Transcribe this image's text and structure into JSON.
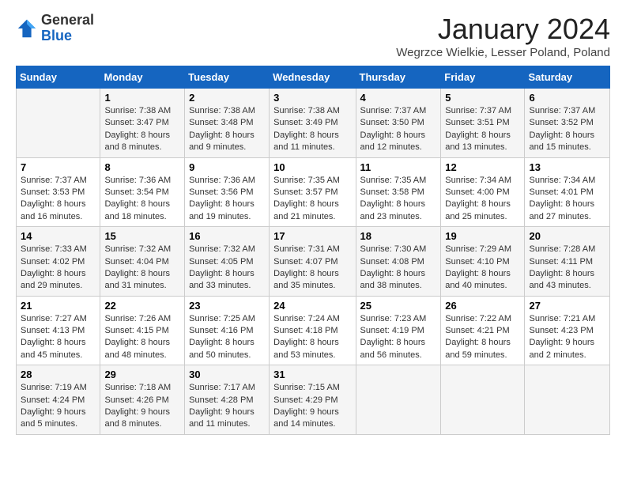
{
  "header": {
    "logo_general": "General",
    "logo_blue": "Blue",
    "month_title": "January 2024",
    "location": "Wegrzce Wielkie, Lesser Poland, Poland"
  },
  "days_of_week": [
    "Sunday",
    "Monday",
    "Tuesday",
    "Wednesday",
    "Thursday",
    "Friday",
    "Saturday"
  ],
  "weeks": [
    [
      {
        "day": "",
        "sunrise": "",
        "sunset": "",
        "daylight": ""
      },
      {
        "day": "1",
        "sunrise": "Sunrise: 7:38 AM",
        "sunset": "Sunset: 3:47 PM",
        "daylight": "Daylight: 8 hours and 8 minutes."
      },
      {
        "day": "2",
        "sunrise": "Sunrise: 7:38 AM",
        "sunset": "Sunset: 3:48 PM",
        "daylight": "Daylight: 8 hours and 9 minutes."
      },
      {
        "day": "3",
        "sunrise": "Sunrise: 7:38 AM",
        "sunset": "Sunset: 3:49 PM",
        "daylight": "Daylight: 8 hours and 11 minutes."
      },
      {
        "day": "4",
        "sunrise": "Sunrise: 7:37 AM",
        "sunset": "Sunset: 3:50 PM",
        "daylight": "Daylight: 8 hours and 12 minutes."
      },
      {
        "day": "5",
        "sunrise": "Sunrise: 7:37 AM",
        "sunset": "Sunset: 3:51 PM",
        "daylight": "Daylight: 8 hours and 13 minutes."
      },
      {
        "day": "6",
        "sunrise": "Sunrise: 7:37 AM",
        "sunset": "Sunset: 3:52 PM",
        "daylight": "Daylight: 8 hours and 15 minutes."
      }
    ],
    [
      {
        "day": "7",
        "sunrise": "Sunrise: 7:37 AM",
        "sunset": "Sunset: 3:53 PM",
        "daylight": "Daylight: 8 hours and 16 minutes."
      },
      {
        "day": "8",
        "sunrise": "Sunrise: 7:36 AM",
        "sunset": "Sunset: 3:54 PM",
        "daylight": "Daylight: 8 hours and 18 minutes."
      },
      {
        "day": "9",
        "sunrise": "Sunrise: 7:36 AM",
        "sunset": "Sunset: 3:56 PM",
        "daylight": "Daylight: 8 hours and 19 minutes."
      },
      {
        "day": "10",
        "sunrise": "Sunrise: 7:35 AM",
        "sunset": "Sunset: 3:57 PM",
        "daylight": "Daylight: 8 hours and 21 minutes."
      },
      {
        "day": "11",
        "sunrise": "Sunrise: 7:35 AM",
        "sunset": "Sunset: 3:58 PM",
        "daylight": "Daylight: 8 hours and 23 minutes."
      },
      {
        "day": "12",
        "sunrise": "Sunrise: 7:34 AM",
        "sunset": "Sunset: 4:00 PM",
        "daylight": "Daylight: 8 hours and 25 minutes."
      },
      {
        "day": "13",
        "sunrise": "Sunrise: 7:34 AM",
        "sunset": "Sunset: 4:01 PM",
        "daylight": "Daylight: 8 hours and 27 minutes."
      }
    ],
    [
      {
        "day": "14",
        "sunrise": "Sunrise: 7:33 AM",
        "sunset": "Sunset: 4:02 PM",
        "daylight": "Daylight: 8 hours and 29 minutes."
      },
      {
        "day": "15",
        "sunrise": "Sunrise: 7:32 AM",
        "sunset": "Sunset: 4:04 PM",
        "daylight": "Daylight: 8 hours and 31 minutes."
      },
      {
        "day": "16",
        "sunrise": "Sunrise: 7:32 AM",
        "sunset": "Sunset: 4:05 PM",
        "daylight": "Daylight: 8 hours and 33 minutes."
      },
      {
        "day": "17",
        "sunrise": "Sunrise: 7:31 AM",
        "sunset": "Sunset: 4:07 PM",
        "daylight": "Daylight: 8 hours and 35 minutes."
      },
      {
        "day": "18",
        "sunrise": "Sunrise: 7:30 AM",
        "sunset": "Sunset: 4:08 PM",
        "daylight": "Daylight: 8 hours and 38 minutes."
      },
      {
        "day": "19",
        "sunrise": "Sunrise: 7:29 AM",
        "sunset": "Sunset: 4:10 PM",
        "daylight": "Daylight: 8 hours and 40 minutes."
      },
      {
        "day": "20",
        "sunrise": "Sunrise: 7:28 AM",
        "sunset": "Sunset: 4:11 PM",
        "daylight": "Daylight: 8 hours and 43 minutes."
      }
    ],
    [
      {
        "day": "21",
        "sunrise": "Sunrise: 7:27 AM",
        "sunset": "Sunset: 4:13 PM",
        "daylight": "Daylight: 8 hours and 45 minutes."
      },
      {
        "day": "22",
        "sunrise": "Sunrise: 7:26 AM",
        "sunset": "Sunset: 4:15 PM",
        "daylight": "Daylight: 8 hours and 48 minutes."
      },
      {
        "day": "23",
        "sunrise": "Sunrise: 7:25 AM",
        "sunset": "Sunset: 4:16 PM",
        "daylight": "Daylight: 8 hours and 50 minutes."
      },
      {
        "day": "24",
        "sunrise": "Sunrise: 7:24 AM",
        "sunset": "Sunset: 4:18 PM",
        "daylight": "Daylight: 8 hours and 53 minutes."
      },
      {
        "day": "25",
        "sunrise": "Sunrise: 7:23 AM",
        "sunset": "Sunset: 4:19 PM",
        "daylight": "Daylight: 8 hours and 56 minutes."
      },
      {
        "day": "26",
        "sunrise": "Sunrise: 7:22 AM",
        "sunset": "Sunset: 4:21 PM",
        "daylight": "Daylight: 8 hours and 59 minutes."
      },
      {
        "day": "27",
        "sunrise": "Sunrise: 7:21 AM",
        "sunset": "Sunset: 4:23 PM",
        "daylight": "Daylight: 9 hours and 2 minutes."
      }
    ],
    [
      {
        "day": "28",
        "sunrise": "Sunrise: 7:19 AM",
        "sunset": "Sunset: 4:24 PM",
        "daylight": "Daylight: 9 hours and 5 minutes."
      },
      {
        "day": "29",
        "sunrise": "Sunrise: 7:18 AM",
        "sunset": "Sunset: 4:26 PM",
        "daylight": "Daylight: 9 hours and 8 minutes."
      },
      {
        "day": "30",
        "sunrise": "Sunrise: 7:17 AM",
        "sunset": "Sunset: 4:28 PM",
        "daylight": "Daylight: 9 hours and 11 minutes."
      },
      {
        "day": "31",
        "sunrise": "Sunrise: 7:15 AM",
        "sunset": "Sunset: 4:29 PM",
        "daylight": "Daylight: 9 hours and 14 minutes."
      },
      {
        "day": "",
        "sunrise": "",
        "sunset": "",
        "daylight": ""
      },
      {
        "day": "",
        "sunrise": "",
        "sunset": "",
        "daylight": ""
      },
      {
        "day": "",
        "sunrise": "",
        "sunset": "",
        "daylight": ""
      }
    ]
  ]
}
